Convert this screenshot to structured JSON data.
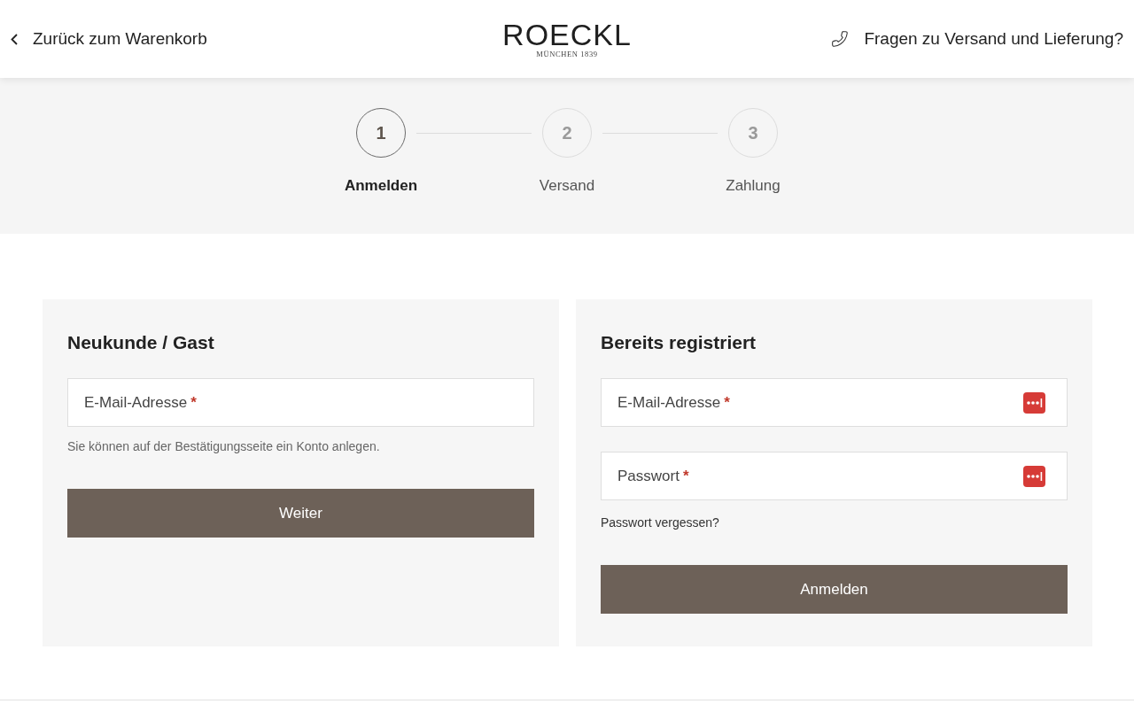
{
  "header": {
    "back_link": "Zurück zum Warenkorb",
    "logo": {
      "wordmark": "ROECKL",
      "tagline": "MÜNCHEN 1839"
    },
    "help_link": "Fragen zu Versand und Lieferung?"
  },
  "steps": [
    {
      "number": "1",
      "label": "Anmelden",
      "selected": true
    },
    {
      "number": "2",
      "label": "Versand",
      "selected": false
    },
    {
      "number": "3",
      "label": "Zahlung",
      "selected": false
    }
  ],
  "panels": [
    {
      "title": "Neukunde / Gast",
      "fields": [
        {
          "label": "E-Mail-Adresse",
          "required_mark": "*",
          "password_manager_icon": false
        }
      ],
      "hint": "Sie können auf der Bestätigungsseite ein Konto anlegen.",
      "button": "Weiter"
    },
    {
      "title": "Bereits registriert",
      "fields": [
        {
          "label": "E-Mail-Adresse",
          "required_mark": "*",
          "password_manager_icon": true
        },
        {
          "label": "Passwort",
          "required_mark": "*",
          "password_manager_icon": true
        }
      ],
      "link": "Passwort vergessen?",
      "button": "Anmelden"
    }
  ]
}
